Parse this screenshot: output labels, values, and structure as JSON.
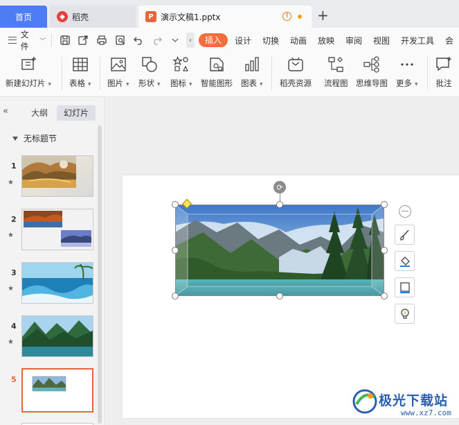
{
  "tabs": {
    "home": "首页",
    "daoke": "稻壳",
    "document": "演示文稿1.pptx"
  },
  "menu": {
    "file": "文件",
    "tabs": [
      "插入",
      "设计",
      "切换",
      "动画",
      "放映",
      "审阅",
      "视图",
      "开发工具",
      "会"
    ],
    "active_tab": "插入"
  },
  "ribbon": {
    "new_slide": "新建幻灯片",
    "table": "表格",
    "picture": "图片",
    "shape": "形状",
    "icon": "图标",
    "smart_graphic": "智能图形",
    "chart": "图表",
    "daoke_resources": "稻壳资源",
    "flowchart": "流程图",
    "mindmap": "思维导图",
    "more": "更多",
    "comment": "批注"
  },
  "left_panel": {
    "tab_outline": "大纲",
    "tab_slides": "幻灯片",
    "section_title": "无标题节",
    "slides": [
      {
        "number": "1",
        "star": "★"
      },
      {
        "number": "2",
        "star": "★"
      },
      {
        "number": "3",
        "star": "★"
      },
      {
        "number": "4",
        "star": "★"
      },
      {
        "number": "5",
        "star": ""
      }
    ],
    "active_slide": "5"
  },
  "watermark": {
    "text": "极光下载站",
    "url": "www.xz7.com"
  },
  "colors": {
    "accent": "#f46d3a",
    "home_tab": "#4d7cf4",
    "active_slide": "#e8643a",
    "watermark": "#2a5fb0"
  }
}
